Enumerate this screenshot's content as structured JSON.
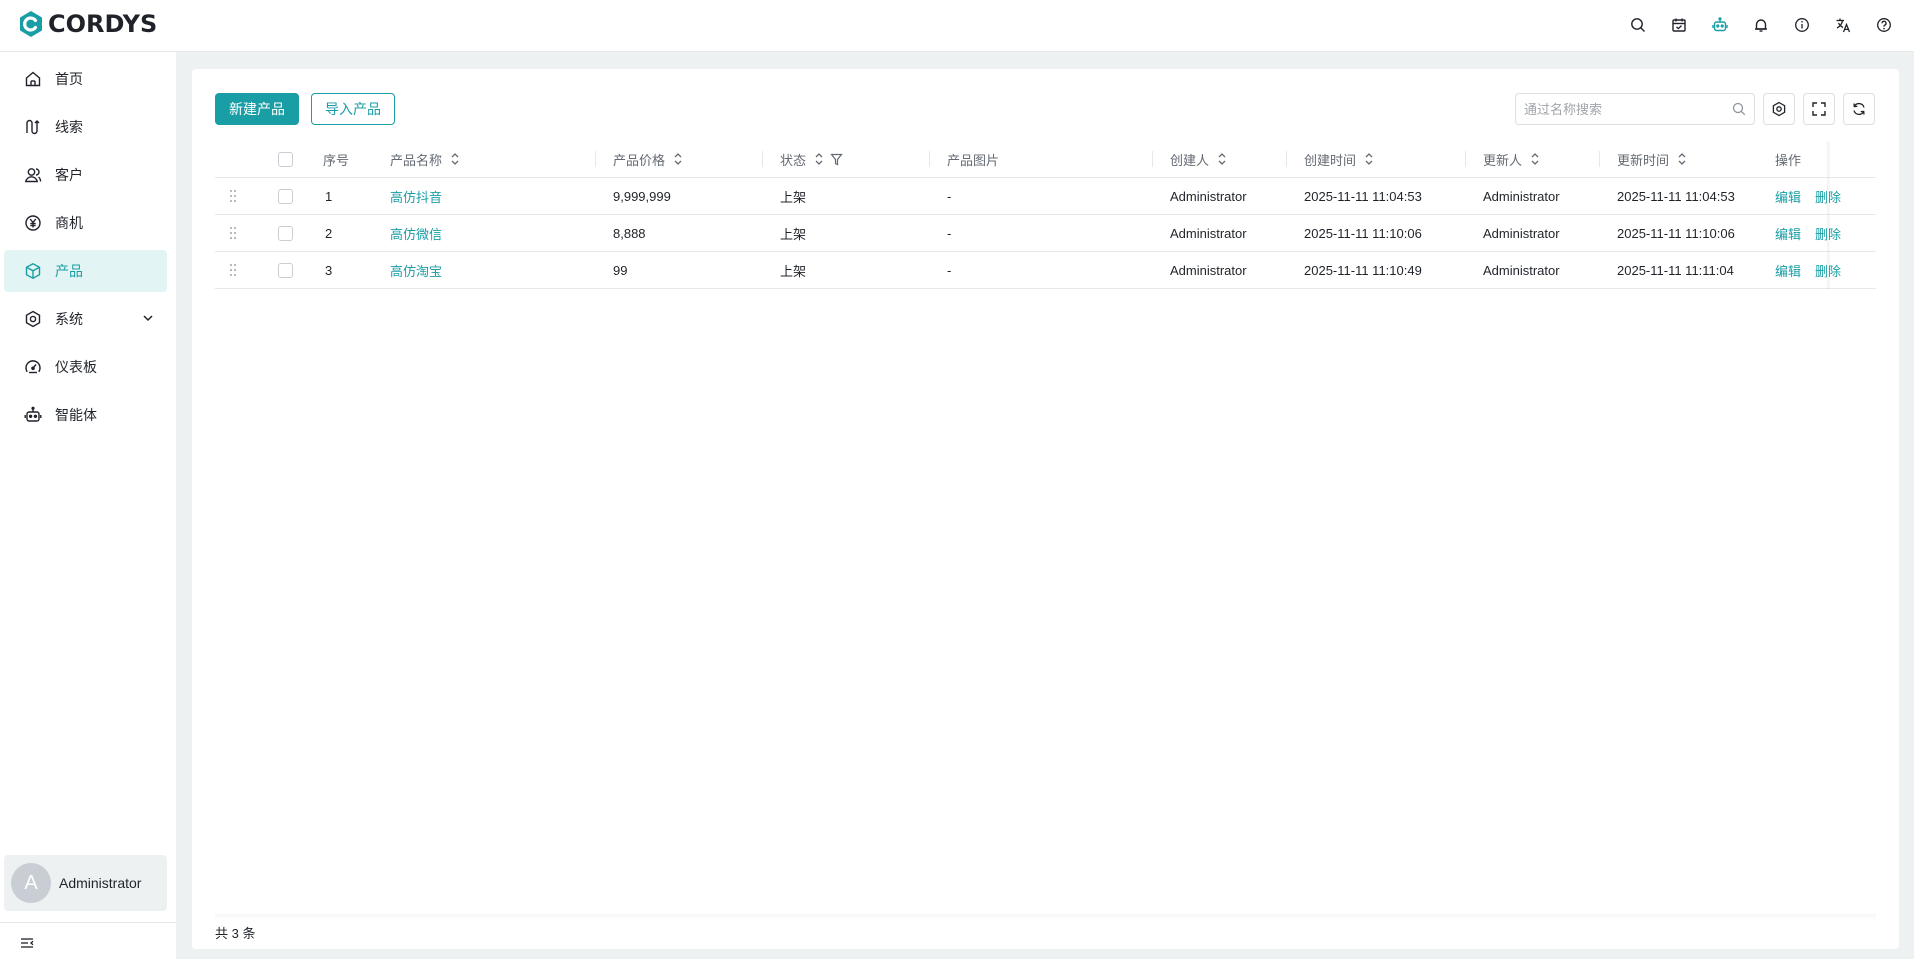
{
  "app": {
    "logo_text": "CORDYS",
    "brand_color": "#1a9ea5"
  },
  "header": {
    "icons": [
      "search-icon",
      "calendar-icon",
      "robot-icon",
      "bell-icon",
      "info-icon",
      "translate-icon",
      "help-icon"
    ]
  },
  "sidebar": {
    "items": [
      {
        "label": "首页",
        "icon": "home-icon"
      },
      {
        "label": "线索",
        "icon": "clue-icon"
      },
      {
        "label": "客户",
        "icon": "customer-icon"
      },
      {
        "label": "商机",
        "icon": "opportunity-icon"
      },
      {
        "label": "产品",
        "icon": "product-icon",
        "active": true
      },
      {
        "label": "系统",
        "icon": "system-icon",
        "expandable": true
      },
      {
        "label": "仪表板",
        "icon": "dashboard-icon"
      },
      {
        "label": "智能体",
        "icon": "agent-icon"
      }
    ],
    "user": {
      "avatar_letter": "A",
      "name": "Administrator"
    }
  },
  "toolbar": {
    "new_label": "新建产品",
    "import_label": "导入产品",
    "search_placeholder": "通过名称搜索"
  },
  "table": {
    "columns": {
      "index": "序号",
      "name": "产品名称",
      "price": "产品价格",
      "status": "状态",
      "image": "产品图片",
      "creator": "创建人",
      "created": "创建时间",
      "updater": "更新人",
      "updated": "更新时间",
      "ops": "操作"
    },
    "rows": [
      {
        "index": "1",
        "name": "高仿抖音",
        "price": "9,999,999",
        "status": "上架",
        "image": "-",
        "creator": "Administrator",
        "created": "2025-11-11 11:04:53",
        "updater": "Administrator",
        "updated": "2025-11-11 11:04:53",
        "edit": "编辑",
        "delete": "删除"
      },
      {
        "index": "2",
        "name": "高仿微信",
        "price": "8,888",
        "status": "上架",
        "image": "-",
        "creator": "Administrator",
        "created": "2025-11-11 11:10:06",
        "updater": "Administrator",
        "updated": "2025-11-11 11:10:06",
        "edit": "编辑",
        "delete": "删除"
      },
      {
        "index": "3",
        "name": "高仿淘宝",
        "price": "99",
        "status": "上架",
        "image": "-",
        "creator": "Administrator",
        "created": "2025-11-11 11:10:49",
        "updater": "Administrator",
        "updated": "2025-11-11 11:11:04",
        "edit": "编辑",
        "delete": "删除"
      }
    ]
  },
  "footer": {
    "total": "共 3 条"
  }
}
